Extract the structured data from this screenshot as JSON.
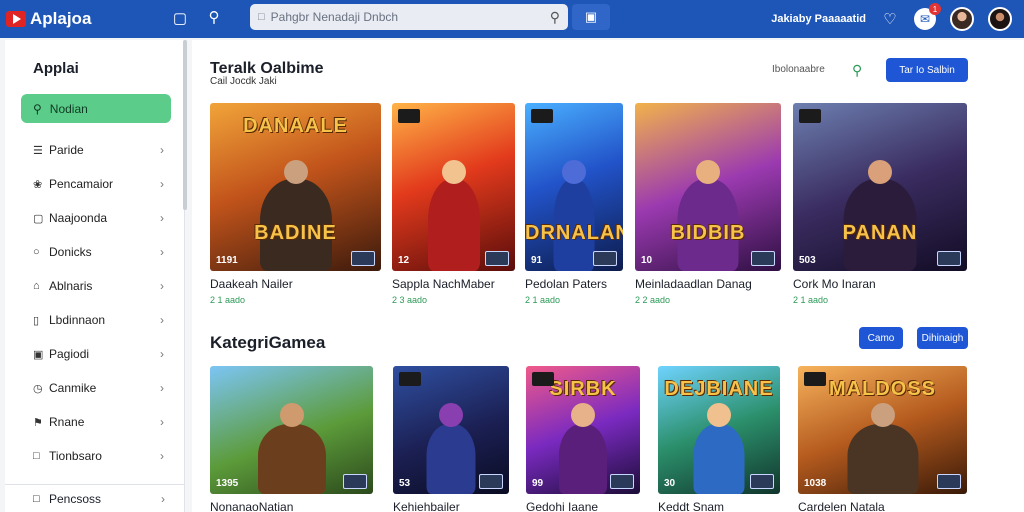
{
  "topbar": {
    "logo_text": "Aplajoa",
    "search_placeholder": "Pahgbr Nenadaji Dnbch",
    "brand_label": "Jakiaby Paaaaatid",
    "notification_count": "1"
  },
  "sidebar": {
    "title": "Applai",
    "active_item": "Nodian",
    "items": [
      {
        "label": "Paride",
        "icon": "list-icon"
      },
      {
        "label": "Pencamaior",
        "icon": "tag-icon"
      },
      {
        "label": "Naajoonda",
        "icon": "folder-icon"
      },
      {
        "label": "Donicks",
        "icon": "chat-icon"
      },
      {
        "label": "Ablnaris",
        "icon": "home-icon"
      },
      {
        "label": "Lbdinnaon",
        "icon": "bookmark-icon"
      },
      {
        "label": "Pagiodi",
        "icon": "image-icon"
      },
      {
        "label": "Canmike",
        "icon": "clock-icon"
      },
      {
        "label": "Rnane",
        "icon": "pin-icon"
      },
      {
        "label": "Tionbsaro",
        "icon": "file-icon"
      }
    ],
    "footer_item": "Pencsoss"
  },
  "section1": {
    "title": "Teralk Oalbime",
    "subtitle": "Cail Jocdk Jaki",
    "link": "Ibolonaabre",
    "button": "Tar Io Salbin",
    "cards": [
      {
        "thumb_title": "DANAALE",
        "thumb_title_bottom": "BADINE",
        "count": "1191",
        "title": "Daakeah Nailer",
        "meta": "2 1 aado",
        "bg": "linear-gradient(160deg,#f1a43a 0%,#c2541b 45%,#3c1a0c 100%)",
        "fig": "#3b2a20",
        "head": "#caa07e"
      },
      {
        "thumb_title": "",
        "thumb_title_bottom": "",
        "count": "12",
        "title": "Sappla NachMaber",
        "meta": "2 3 aado",
        "bg": "linear-gradient(160deg,#ffb347 0%,#e23a1c 45%,#5a0d0b 100%)",
        "fig": "#b01f1d",
        "head": "#f2c28f"
      },
      {
        "thumb_title": "",
        "thumb_title_bottom": "DRNALAN",
        "count": "91",
        "title": "Pedolan Paters",
        "meta": "2 1 aado",
        "bg": "linear-gradient(160deg,#4ab0ff 0%,#2253c9 45%,#0d1c4c 100%)",
        "fig": "#1f3fa0",
        "head": "#4d6cd8"
      },
      {
        "thumb_title": "",
        "thumb_title_bottom": "BIDBIB",
        "count": "10",
        "title": "Meinladaadlan Danag",
        "meta": "2 2 aado",
        "bg": "linear-gradient(160deg,#f2b24b 0%,#9b3ab0 50%,#2e1042 100%)",
        "fig": "#6b2a8c",
        "head": "#e8b07e"
      },
      {
        "thumb_title": "",
        "thumb_title_bottom": "PANAN",
        "count": "503",
        "title": "Cork Mo Inaran",
        "meta": "2 1 aado",
        "bg": "linear-gradient(160deg,#6d7fb0 0%,#3a2c60 50%,#120c24 100%)",
        "fig": "#2a1c3a",
        "head": "#d9a07a"
      }
    ]
  },
  "section2": {
    "title": "KategriGamea",
    "button1": "Camo",
    "button2": "Dihinaigh",
    "cards": [
      {
        "thumb_title": "",
        "thumb_title_bottom": "",
        "count": "1395",
        "title": "NonanaoNatian",
        "bg": "linear-gradient(160deg,#7cc5f5 0%,#5c9b3a 55%,#2c4a1c 100%)",
        "fig": "#6b3f1d",
        "head": "#cf9a6e"
      },
      {
        "thumb_title": "",
        "thumb_title_bottom": "",
        "count": "53",
        "title": "Kehiehbailer",
        "bg": "linear-gradient(160deg,#2f4fa0 0%,#1b1f52 55%,#0a0c22 100%)",
        "fig": "#2b3b8f",
        "head": "#8a3fb0"
      },
      {
        "thumb_title": "SIRBK",
        "thumb_title_bottom": "",
        "count": "99",
        "title": "Gedohi Iaane",
        "bg": "linear-gradient(160deg,#f05a8a 0%,#7a2ac0 50%,#1c0d38 100%)",
        "fig": "#5a1f7a",
        "head": "#e7b189"
      },
      {
        "thumb_title": "DEJBIANE",
        "thumb_title_bottom": "",
        "count": "30",
        "title": "Keddt Snam",
        "bg": "linear-gradient(160deg,#6fd3ff 0%,#2b8f6b 50%,#11352c 100%)",
        "fig": "#2d6ac4",
        "head": "#f0c08e"
      },
      {
        "thumb_title": "MALDOSS",
        "thumb_title_bottom": "",
        "count": "1038",
        "title": "Cardelen Natala",
        "bg": "linear-gradient(160deg,#f7b35c 0%,#b45a1e 50%,#3a1a08 100%)",
        "fig": "#4a3424",
        "head": "#caa07e"
      }
    ]
  },
  "colors": {
    "topbar": "#1e56b8",
    "accent_green": "#5ccc8a",
    "primary_button": "#1e56d6"
  }
}
